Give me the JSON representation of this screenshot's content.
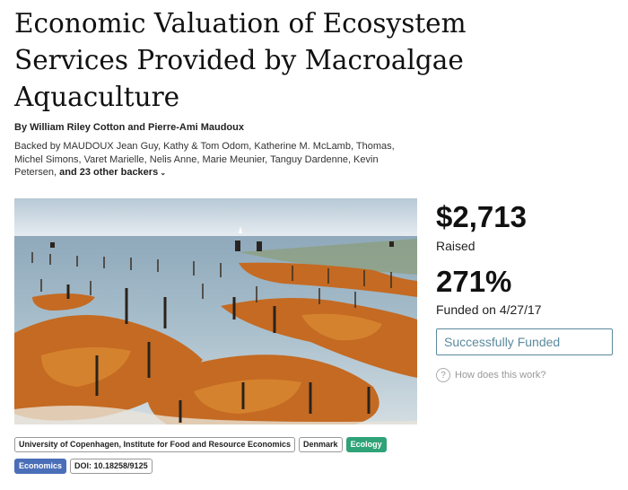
{
  "title": "Economic Valuation of Ecosystem Services Provided by Macroalgae Aquaculture",
  "authors": "By William Riley Cotton and Pierre-Ami Maudoux",
  "backers": {
    "prefix": "Backed by MAUDOUX Jean Guy, Kathy & Tom Odom, Katherine M. McLamb, Thomas, Michel Simons, Varet Marielle, Nelis Anne, Marie Meunier, Tanguy Dardenne, Kevin Petersen, ",
    "more_link": "and 23 other backers",
    "more_icon": "chevron-down-icon"
  },
  "hero_image": "seaweed farm at low tide with people working",
  "stats": {
    "amount": "$2,713",
    "amount_label": "Raised",
    "percent": "271%",
    "funded_on": "Funded on 4/27/17",
    "status": "Successfully Funded",
    "help_icon": "question-circle-icon",
    "help_text": "How does this work?"
  },
  "tags": {
    "row1": [
      {
        "label": "University of Copenhagen, Institute for Food and Resource Economics",
        "style": "outline"
      },
      {
        "label": "Denmark",
        "style": "outline"
      },
      {
        "label": "Ecology",
        "style": "green",
        "color": "#2fa377"
      }
    ],
    "row2": [
      {
        "label": "Economics",
        "style": "blue",
        "color": "#4a6fb8"
      },
      {
        "label": "DOI: 10.18258/9125",
        "style": "outline"
      }
    ]
  }
}
